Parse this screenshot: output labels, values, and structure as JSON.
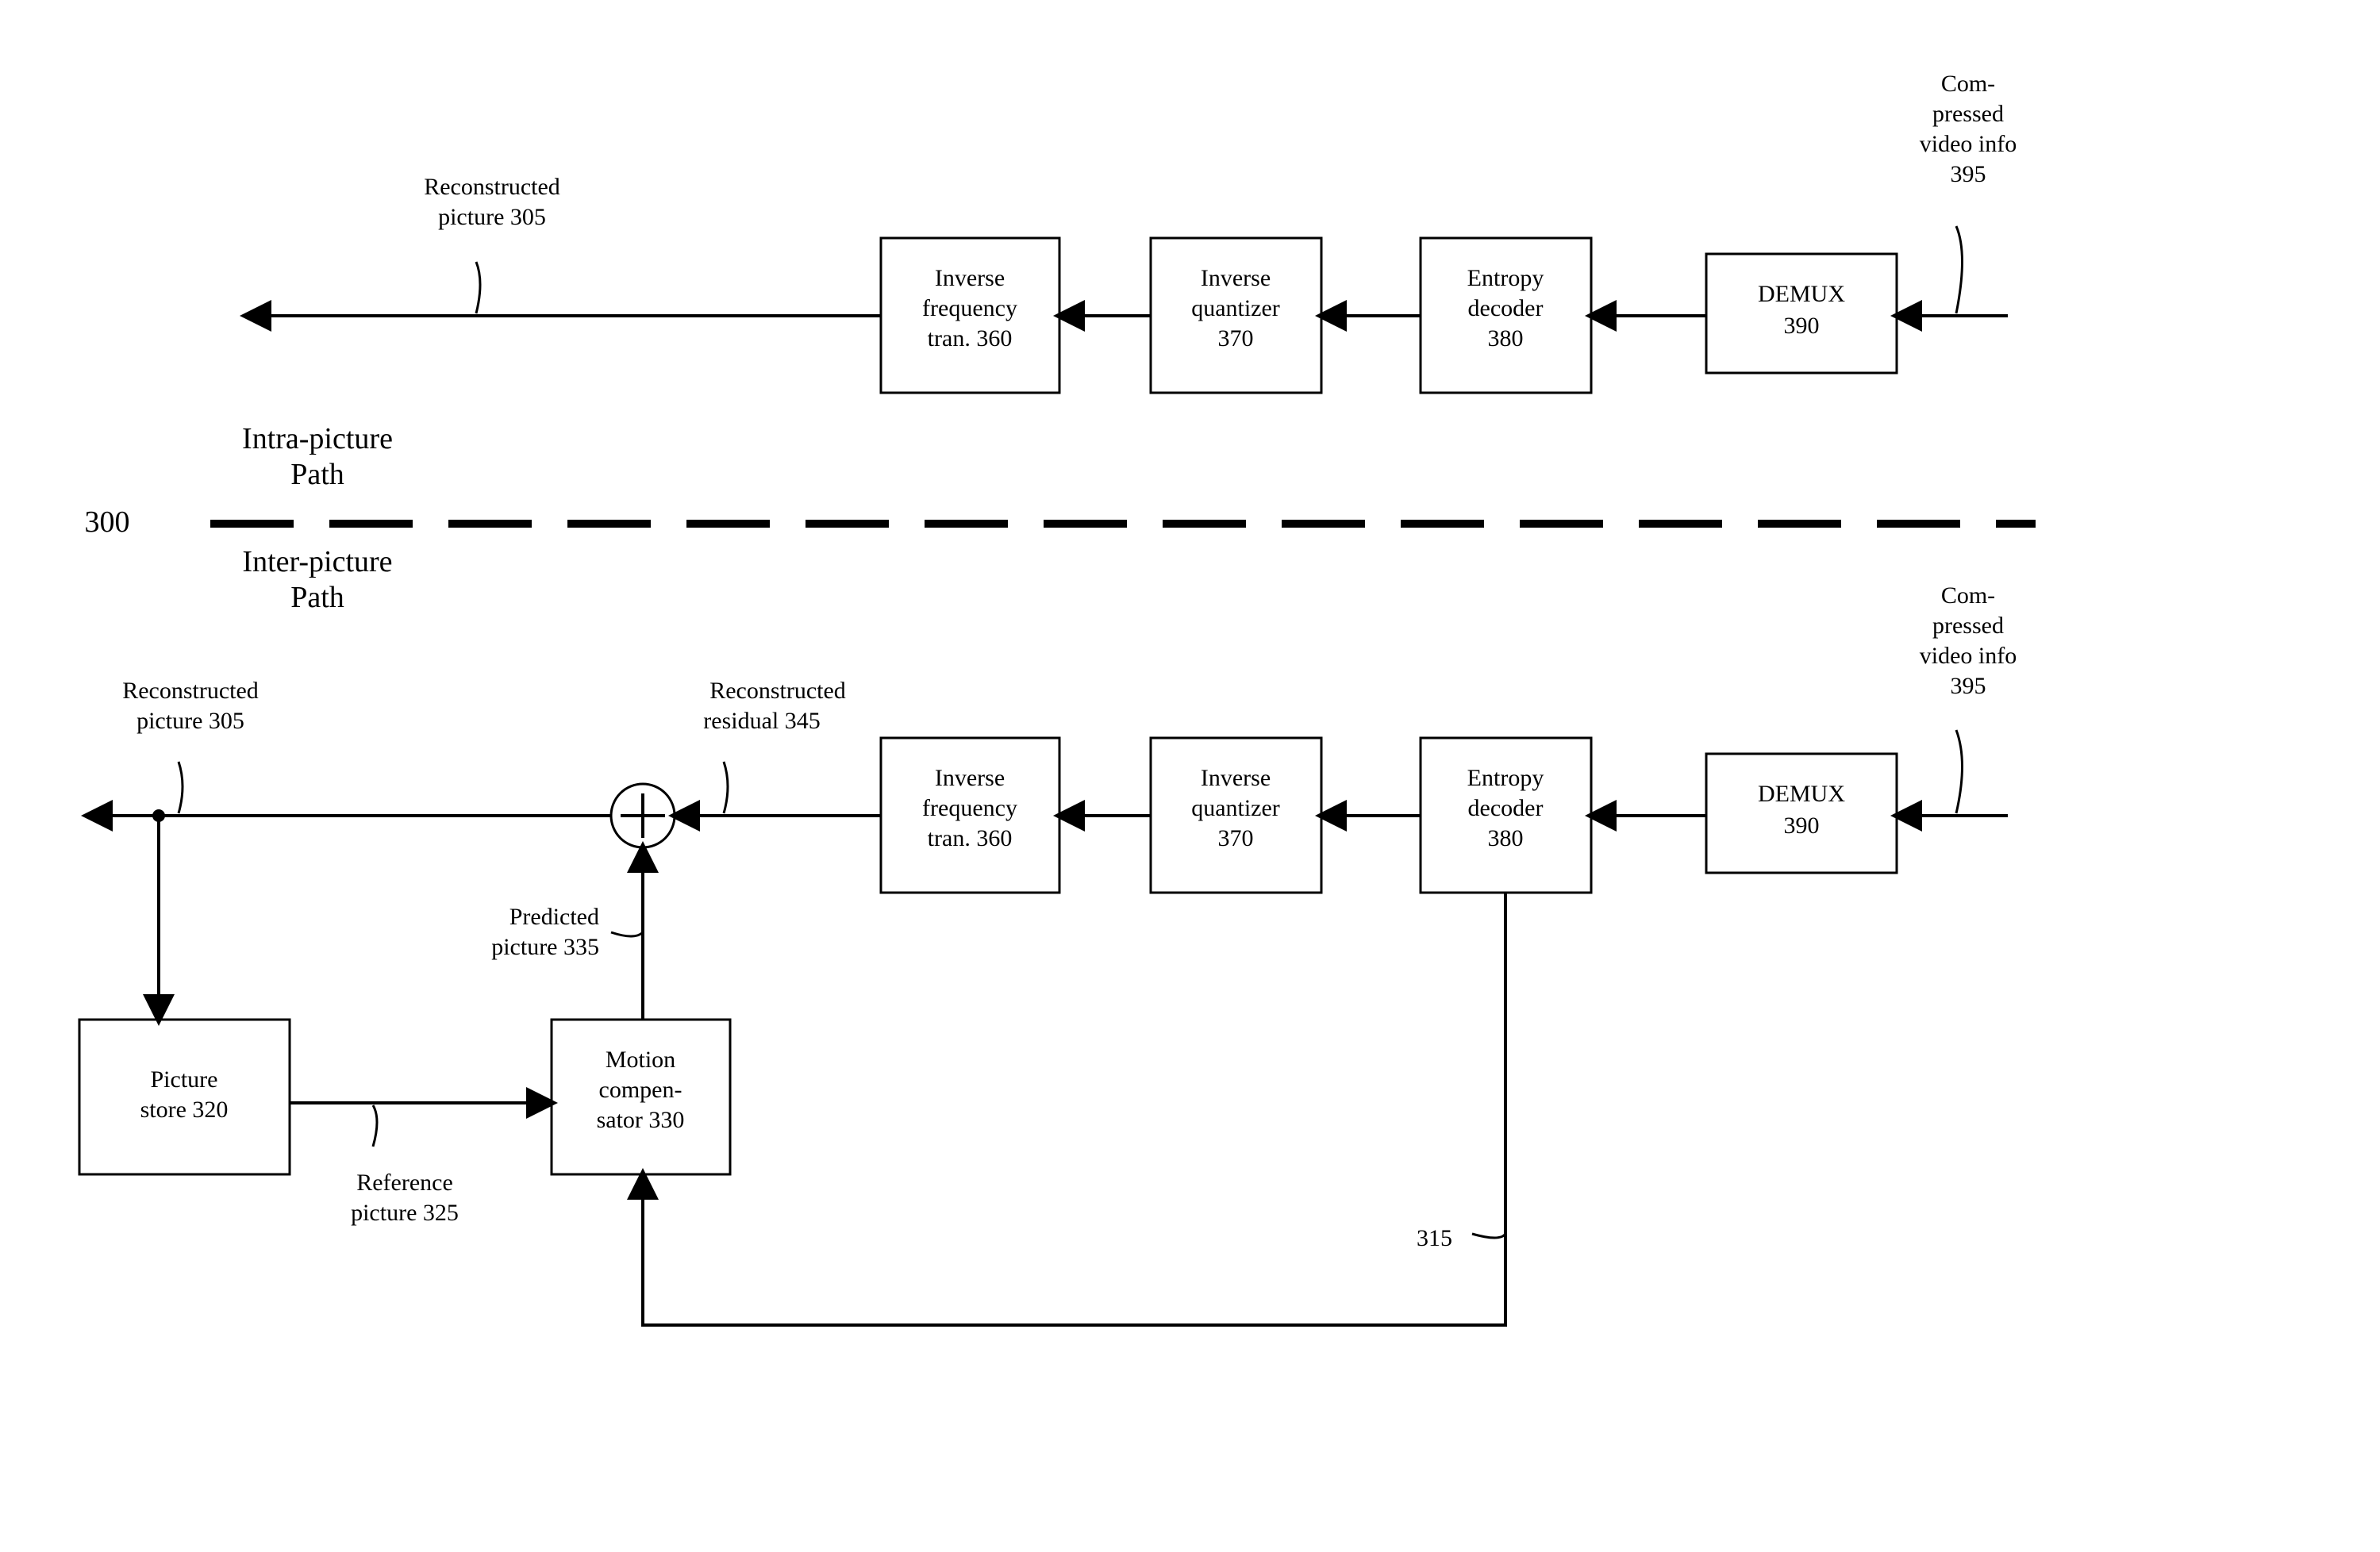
{
  "diagram_ref": "300",
  "section_labels": {
    "intra_line1": "Intra-picture",
    "intra_line2": "Path",
    "inter_line1": "Inter-picture",
    "inter_line2": "Path"
  },
  "signals": {
    "reconstructed_picture_line1": "Reconstructed",
    "reconstructed_picture_line2": "picture 305",
    "reconstructed_residual_line1": "Reconstructed",
    "reconstructed_residual_line2": "residual 345",
    "predicted_picture_line1": "Predicted",
    "predicted_picture_line2": "picture 335",
    "reference_picture_line1": "Reference",
    "reference_picture_line2": "picture 325",
    "compressed_line1": "Com-",
    "compressed_line2": "pressed",
    "compressed_line3": "video info",
    "compressed_line4": "395",
    "mv_info": "315"
  },
  "blocks": {
    "demux_line1": "DEMUX",
    "demux_line2": "390",
    "entropy_line1": "Entropy",
    "entropy_line2": "decoder",
    "entropy_line3": "380",
    "iq_line1": "Inverse",
    "iq_line2": "quantizer",
    "iq_line3": "370",
    "ift_line1": "Inverse",
    "ift_line2": "frequency",
    "ift_line3": "tran. 360",
    "picstore_line1": "Picture",
    "picstore_line2": "store 320",
    "mc_line1": "Motion",
    "mc_line2": "compen-",
    "mc_line3": "sator 330"
  }
}
